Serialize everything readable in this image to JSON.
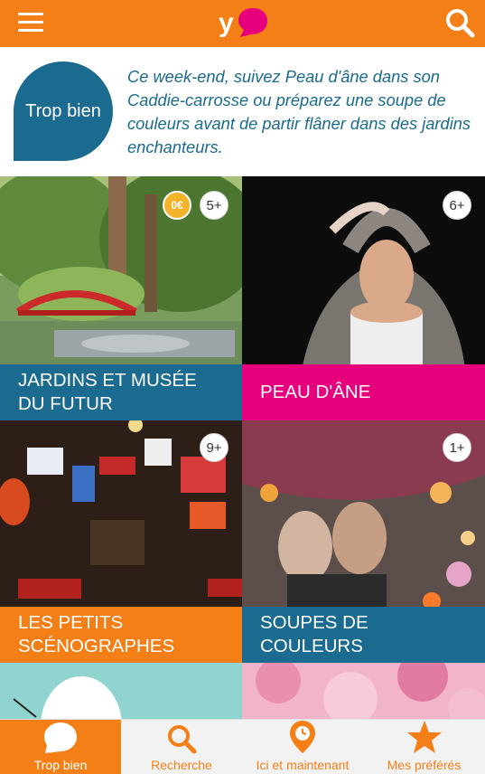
{
  "header": {
    "menu_icon": "hamburger-icon",
    "logo_icon": "yoop-logo",
    "logo_letter": "y",
    "search_icon": "search-icon",
    "brand_color": "#f47f16"
  },
  "intro": {
    "badge_label": "Trop bien",
    "text": "Ce week-end, suivez Peau d'âne dans son Caddie-carrosse ou préparez une soupe de couleurs avant de partir flâner dans des jardins enchanteurs.",
    "accent_color": "#1b6a8f"
  },
  "cards": [
    {
      "title": "JARDINS ET MUSÉE DU FUTUR",
      "price": "0€",
      "age": "5+",
      "caption_color": "#1b6a8f"
    },
    {
      "title": "PEAU D'ÂNE",
      "age": "6+",
      "caption_color": "#e6007e"
    },
    {
      "title": "LES PETITS SCÉNOGRAPHES",
      "age": "9+",
      "caption_color": "#f47f16"
    },
    {
      "title": "SOUPES DE COULEURS",
      "age": "1+",
      "caption_color": "#1b6a8f"
    }
  ],
  "bottom_nav": [
    {
      "label": "Trop bien",
      "icon": "speech-bubble-icon",
      "active": true
    },
    {
      "label": "Recherche",
      "icon": "search-icon",
      "active": false
    },
    {
      "label": "Ici et maintenant",
      "icon": "location-clock-icon",
      "active": false
    },
    {
      "label": "Mes préférés",
      "icon": "star-icon",
      "active": false
    }
  ]
}
